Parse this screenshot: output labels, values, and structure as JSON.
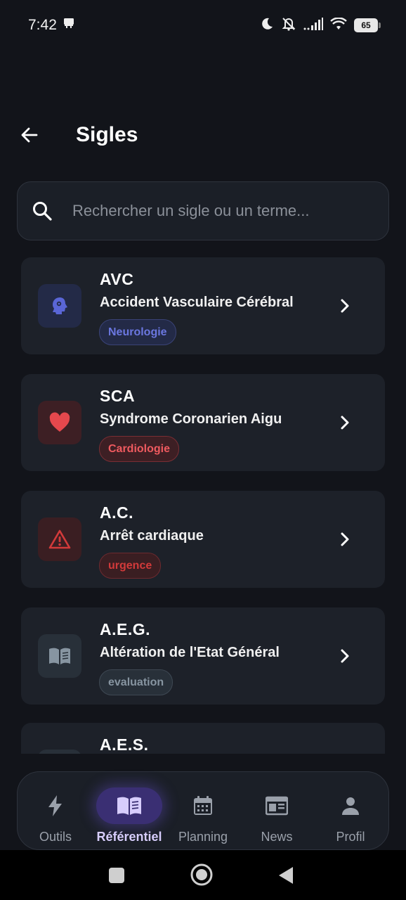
{
  "status_bar": {
    "time": "7:42",
    "battery": "65"
  },
  "header": {
    "title": "Sigles"
  },
  "search": {
    "placeholder": "Rechercher un sigle ou un terme..."
  },
  "items": [
    {
      "code": "AVC",
      "label": "Accident Vasculaire Cérébral",
      "tag": "Neurologie",
      "icon": "brain-icon",
      "accent": "#5a66d6"
    },
    {
      "code": "SCA",
      "label": "Syndrome Coronarien Aigu",
      "tag": "Cardiologie",
      "icon": "heart-icon",
      "accent": "#e5484d"
    },
    {
      "code": "A.C.",
      "label": "Arrêt cardiaque",
      "tag": "urgence",
      "icon": "warning-icon",
      "accent": "#d23a3a"
    },
    {
      "code": "A.E.G.",
      "label": "Altération de l'Etat Général",
      "tag": "evaluation",
      "icon": "book-icon",
      "accent": "#8795a1"
    },
    {
      "code": "A.E.S.",
      "label": "",
      "tag": "",
      "icon": "book-icon",
      "accent": "#8795a1"
    }
  ],
  "nav": {
    "active": "Référentiel",
    "items": [
      {
        "label": "Outils",
        "icon": "bolt-icon"
      },
      {
        "label": "Référentiel",
        "icon": "book-icon"
      },
      {
        "label": "Planning",
        "icon": "calendar-icon"
      },
      {
        "label": "News",
        "icon": "newspaper-icon"
      },
      {
        "label": "Profil",
        "icon": "person-icon"
      }
    ]
  }
}
